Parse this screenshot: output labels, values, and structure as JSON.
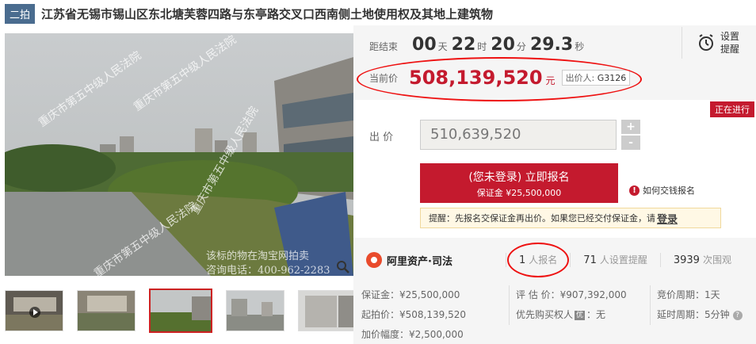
{
  "header": {
    "tag": "二拍",
    "title": "江苏省无锡市锡山区东北塘芙蓉四路与东亭路交叉口西南侧土地使用权及其地上建筑物"
  },
  "gallery": {
    "watermarks": [
      "重庆市第五中级人民法院",
      "重庆市第五中级人民法院",
      "重庆市第五中级人民法院",
      "重庆市第五中级人民法院"
    ],
    "caption_lines": [
      "该标的物在淘宝网拍卖",
      "咨询电话：400-962-2283"
    ]
  },
  "countdown": {
    "label": "距结束",
    "days": "00",
    "days_unit": "天",
    "hours": "22",
    "hours_unit": "时",
    "minutes": "20",
    "minutes_unit": "分",
    "seconds": "29.3",
    "seconds_unit": "秒"
  },
  "reminder": {
    "line1": "设置",
    "line2": "提醒"
  },
  "current_price": {
    "label": "当前价",
    "value": "508,139,520",
    "unit": "元",
    "bidder_label": "出价人:",
    "bidder_id": "G3126"
  },
  "status": "正在进行",
  "bid": {
    "label": "出 价",
    "value": "510,639,520",
    "plus": "+",
    "minus": "-"
  },
  "signup": {
    "main": "(您未登录) 立即报名",
    "sub": "保证金 ¥25,500,000"
  },
  "help": {
    "icon": "!",
    "text": "如何交钱报名"
  },
  "notice": {
    "text": "提醒：先报名交保证金再出价。如果您已经交付保证金，请",
    "link": "登录"
  },
  "brand": {
    "name": "阿里资产·司法"
  },
  "stats": [
    {
      "num": "1",
      "label": "人报名"
    },
    {
      "num": "71",
      "label": "人设置提醒"
    },
    {
      "num": "3939",
      "label": "次围观"
    }
  ],
  "details": {
    "col1": [
      "保证金：¥25,500,000",
      "起拍价：¥508,139,520",
      "加价幅度：¥2,500,000"
    ],
    "col2": {
      "appraisal": "评 估 价：¥907,392,000",
      "priority_pre": "优先购买权人",
      "priority_badge": "优",
      "priority_post": "：无"
    },
    "col3": [
      "竞价周期：1天",
      "延时周期：5分钟"
    ]
  },
  "colors": {
    "accent": "#c41a2e",
    "tag": "#4a6c8f",
    "annotation": "#e11111"
  }
}
